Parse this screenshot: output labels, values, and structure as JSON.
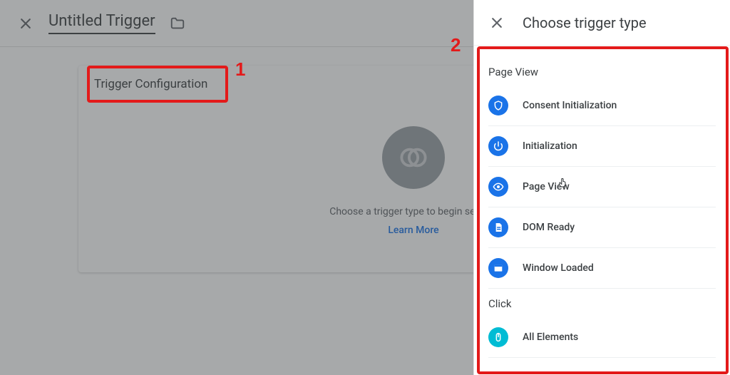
{
  "header": {
    "title": "Untitled Trigger"
  },
  "card": {
    "title": "Trigger Configuration",
    "prompt": "Choose a trigger type to begin setup...",
    "learn_more": "Learn More"
  },
  "panel": {
    "title": "Choose trigger type",
    "groups": [
      {
        "label": "Page View",
        "items": [
          {
            "label": "Consent Initialization",
            "icon": "shield",
            "color": "blue"
          },
          {
            "label": "Initialization",
            "icon": "power",
            "color": "blue"
          },
          {
            "label": "Page View",
            "icon": "eye",
            "color": "blue",
            "hover": true
          },
          {
            "label": "DOM Ready",
            "icon": "doc",
            "color": "blue"
          },
          {
            "label": "Window Loaded",
            "icon": "window",
            "color": "blue"
          }
        ]
      },
      {
        "label": "Click",
        "items": [
          {
            "label": "All Elements",
            "icon": "mouse",
            "color": "cyan"
          }
        ]
      }
    ]
  },
  "annotations": {
    "n1": "1",
    "n2": "2"
  }
}
